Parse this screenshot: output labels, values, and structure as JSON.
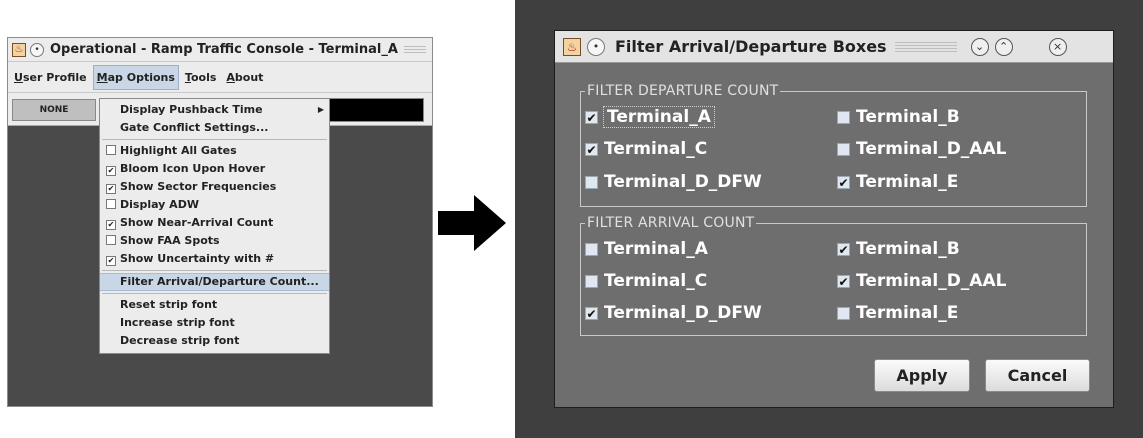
{
  "console": {
    "title": "Operational - Ramp Traffic Console - Terminal_A",
    "menu": [
      {
        "label": "User Profile",
        "mnemonic": "U",
        "rest": "ser Profile"
      },
      {
        "label": "Map Options",
        "mnemonic": "M",
        "rest": "ap Options"
      },
      {
        "label": "Tools",
        "mnemonic": "T",
        "rest": "ools"
      },
      {
        "label": "About",
        "mnemonic": "A",
        "rest": "bout"
      }
    ],
    "none_label": "NONE",
    "dropdown": {
      "display_pushback": "Display Pushback Time",
      "gate_conflict": "Gate Conflict Settings...",
      "checks": [
        {
          "label": "Highlight All Gates",
          "checked": false
        },
        {
          "label": "Bloom Icon Upon Hover",
          "checked": true
        },
        {
          "label": "Show Sector Frequencies",
          "checked": true
        },
        {
          "label": "Display ADW",
          "checked": false
        },
        {
          "label": "Show Near-Arrival Count",
          "checked": true
        },
        {
          "label": "Show FAA Spots",
          "checked": false
        },
        {
          "label": "Show Uncertainty with #",
          "checked": true
        }
      ],
      "filter": "Filter Arrival/Departure Count...",
      "reset_font": "Reset strip font",
      "increase_font": "Increase strip font",
      "decrease_font": "Decrease strip font"
    }
  },
  "dialog": {
    "title": "Filter Arrival/Departure Boxes",
    "departure_legend": "FILTER DEPARTURE COUNT",
    "arrival_legend": "FILTER ARRIVAL COUNT",
    "departure": [
      {
        "label": "Terminal_A",
        "checked": true
      },
      {
        "label": "Terminal_B",
        "checked": false
      },
      {
        "label": "Terminal_C",
        "checked": true
      },
      {
        "label": "Terminal_D_AAL",
        "checked": false
      },
      {
        "label": "Terminal_D_DFW",
        "checked": false
      },
      {
        "label": "Terminal_E",
        "checked": true
      }
    ],
    "arrival": [
      {
        "label": "Terminal_A",
        "checked": false
      },
      {
        "label": "Terminal_B",
        "checked": true
      },
      {
        "label": "Terminal_C",
        "checked": false
      },
      {
        "label": "Terminal_D_AAL",
        "checked": true
      },
      {
        "label": "Terminal_D_DFW",
        "checked": true
      },
      {
        "label": "Terminal_E",
        "checked": false
      }
    ],
    "apply_label": "Apply",
    "cancel_label": "Cancel"
  },
  "icons": {
    "check_glyph": "✔",
    "arrow": "arrow-right-icon"
  }
}
